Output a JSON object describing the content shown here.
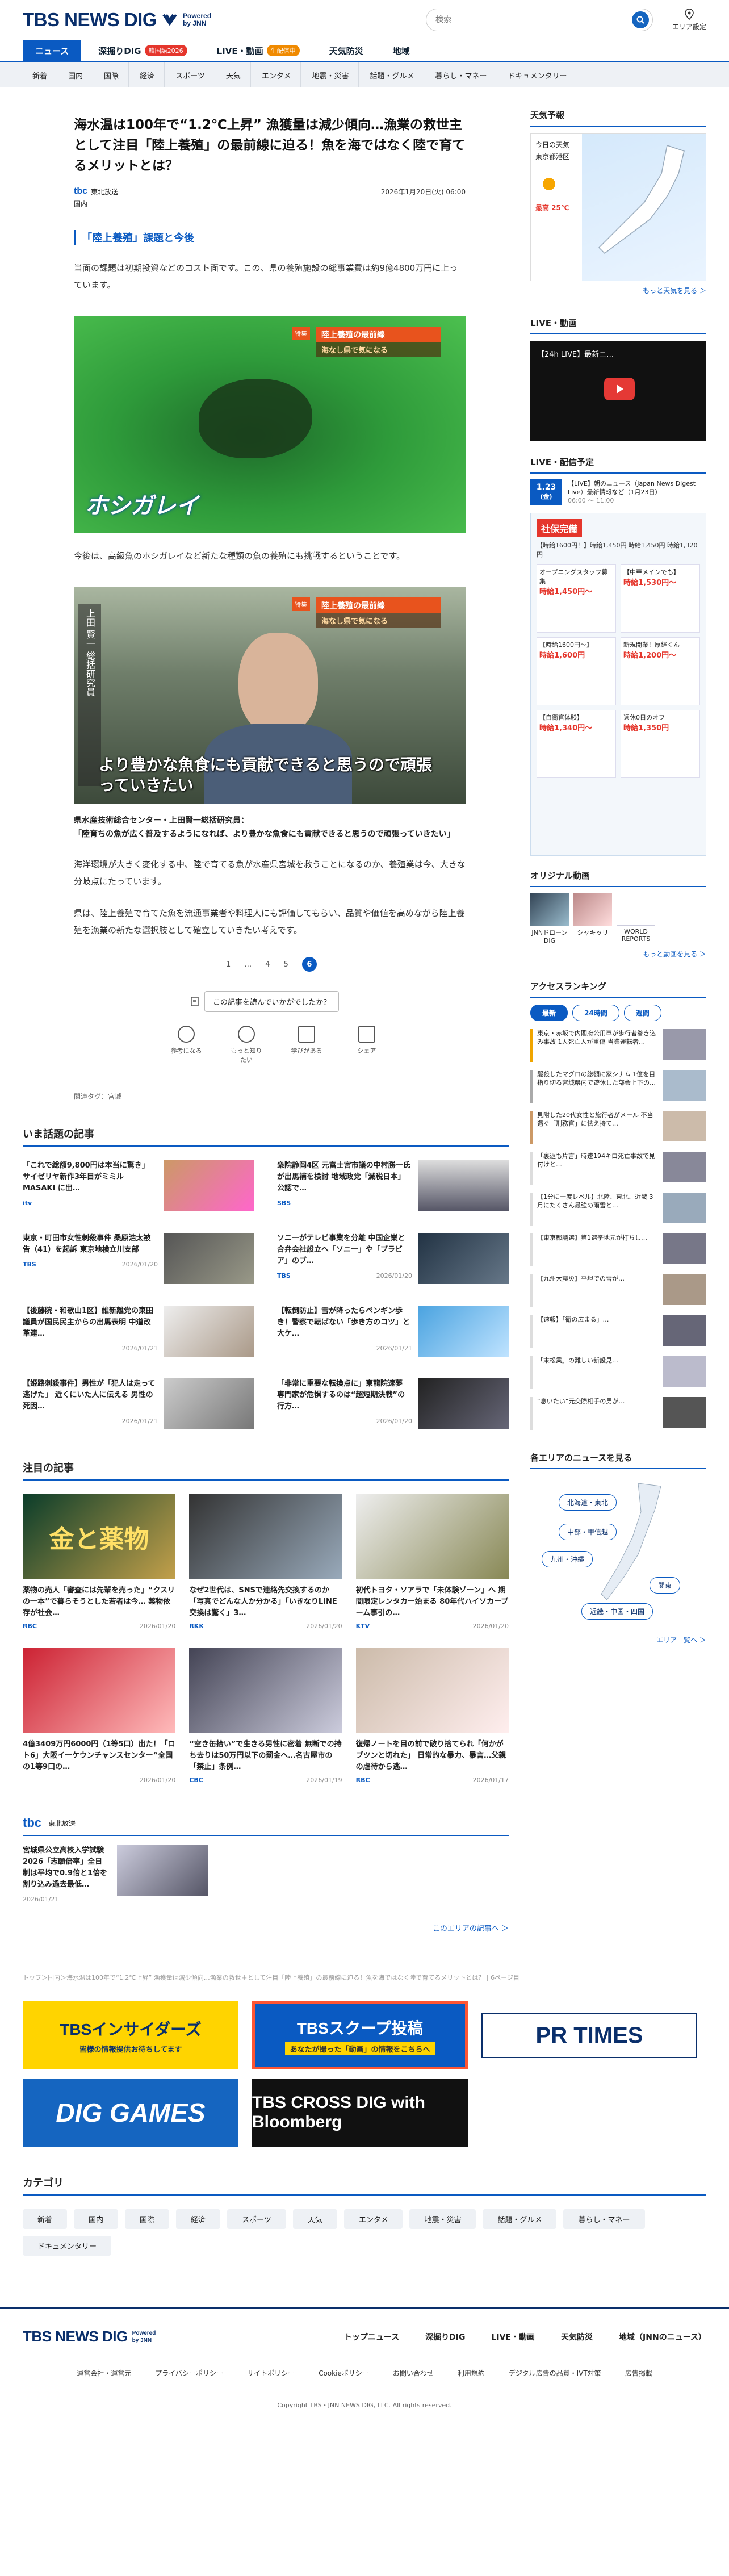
{
  "header": {
    "logo": "TBS NEWS DIG",
    "powered": "Powered",
    "by": "by JNN",
    "search_placeholder": "検索",
    "area_label": "エリア設定"
  },
  "tabs": [
    {
      "label": "ニュース",
      "badge": ""
    },
    {
      "label": "深掘りDIG",
      "badge": "韓国語2026"
    },
    {
      "label": "LIVE・動画",
      "badge": "生配信中"
    },
    {
      "label": "天気防災",
      "badge": ""
    },
    {
      "label": "地域",
      "badge": ""
    }
  ],
  "categories": [
    "新着",
    "国内",
    "国際",
    "経済",
    "スポーツ",
    "天気",
    "エンタメ",
    "地震・災害",
    "話題・グルメ",
    "暮らし・マネー",
    "ドキュメンタリー"
  ],
  "article": {
    "title": "海水温は100年で“1.2℃上昇” 漁獲量は減少傾向…漁業の救世主として注目「陸上養殖」の最前線に迫る！魚を海ではなく陸で育てるメリットとは？",
    "source": "東北放送",
    "source_logo": "tbc",
    "date": "2026年1月20日(火) 06:00",
    "tag": "国内",
    "section_heading": "「陸上養殖」課題と今後",
    "para1": "当面の課題は初期投資などのコスト面です。この、県の養殖施設の総事業費は約9億4800万円に上っています。",
    "img1_caption_tag": "特集",
    "img1_caption_main": "陸上養殖の最前線",
    "img1_caption_sub": "海なし県で気になる",
    "img1_overlay": "ホシガレイ",
    "para2": "今後は、高級魚のホシガレイなど新たな種類の魚の養殖にも挑戦するということです。",
    "img2_caption_tag": "特集",
    "img2_caption_main": "陸上養殖の最前線",
    "img2_caption_sub": "海なし県で気になる",
    "img2_nameband": "上田 賢一 総括研究員",
    "img2_overlay": "より豊かな魚食にも貢献できると思うので頑張っていきたい",
    "speaker": "県水産技術総合センター・上田賢一総括研究員：\n「陸育ちの魚が広く普及するようになれば、より豊かな魚食にも貢献できると思うので頑張っていきたい」",
    "para3": "海洋環境が大きく変化する中、陸で育てる魚が水産県宮城を救うことになるのか、養殖業は今、大きな分岐点にたっています。",
    "para4": "県は、陸上養殖で育てた魚を流通事業者や料理人にも評価してもらい、品質や価値を高めながら陸上養殖を漁業の新たな選択肢として確立していきたい考えです。",
    "pager": [
      "1",
      "…",
      "4",
      "5",
      "6"
    ],
    "feedback_question": "この記事を読んでいかがでしたか？",
    "feedback": [
      "参考になる",
      "もっと知りたい",
      "学びがある",
      "シェア"
    ],
    "related_tag": "関連タグ：宮城"
  },
  "hot_news": {
    "title": "いま話題の記事",
    "items": [
      {
        "text": "「これで総額9,800円は本当に驚き」 サイゼリヤ新作3年目がミミル MASAKI に出…",
        "src": "itv",
        "date": ""
      },
      {
        "text": "衆院静岡4区 元富士宮市議の中村勝一氏が出馬補を検討 地域政党「減税日本」公認で…",
        "src": "SBS",
        "date": ""
      },
      {
        "text": "東京・町田市女性刺殺事件 桑原浩太被告（41）を起訴 東京地検立川支部",
        "src": "TBS",
        "date": "2026/01/20"
      },
      {
        "text": "ソニーがテレビ事業を分離 中国企業と合弁会社設立へ「ソニー」や「ブラビア」のブ…",
        "src": "TBS",
        "date": "2026/01/20"
      },
      {
        "text": "【後藤院・和歌山1区】維新離党の東田議員が国民民主からの出馬表明 中道改革連…",
        "src": "",
        "date": "2026/01/21"
      },
      {
        "text": "【転倒防止】雪が降ったらペンギン歩き！警察で転ばない「歩き方のコツ」と大ケ…",
        "src": "",
        "date": "2026/01/21"
      },
      {
        "text": "【姫路刺殺事件】男性が「犯人は走って逃げた」 近くにいた人に伝える 男性の死因…",
        "src": "",
        "date": "2026/01/21"
      },
      {
        "text": "「非常に重要な転換点に」東龍院速夢 専門家が危惧するのは“超短期決戦”の行方…",
        "src": "",
        "date": "2026/01/20"
      }
    ]
  },
  "featured": {
    "title": "注目の記事",
    "items": [
      {
        "text": "薬物の売人「審査には先輩を売った」“クスリの一本”で暮らそうとした若者は今… 薬物依存が社会…",
        "src": "RBC",
        "date": "2026/01/20",
        "overlay": "金と薬物"
      },
      {
        "text": "なぜ2世代は、SNSで連絡先交換するのか「写真でどんな人か分かる」「いきなりLINE交換は驚く」3…",
        "src": "RKK",
        "date": "2026/01/20",
        "overlay": ""
      },
      {
        "text": "初代トヨタ・ソアラで「未体験ゾーン」へ 期間限定レンタカー始まる 80年代ハイソカーブーム事引の…",
        "src": "KTV",
        "date": "2026/01/20",
        "overlay": ""
      },
      {
        "text": "4億3409万円6000円（1等5口）出た！「ロト6」大阪イーケウンチャンスセンター“全国の1等9口の…",
        "src": "",
        "date": "2026/01/20",
        "overlay": ""
      },
      {
        "text": "“空き缶拾い”で生きる男性に密着 無断での持ち去りは50万円以下の罰金へ…名古屋市の「禁止」条例…",
        "src": "CBC",
        "date": "2026/01/19",
        "overlay": ""
      },
      {
        "text": "復帰ノートを目の前で破り捨てられ「何かがプツンと切れた」 日常的な暴力、暴言…父親の虐待から逃…",
        "src": "RBC",
        "date": "2026/01/17",
        "overlay": ""
      }
    ]
  },
  "local": {
    "source": "東北放送",
    "text": "宮城県公立高校入学試験2026「志願倍率」全日制は平均で0.9倍と1倍を割り込み過去最低…",
    "date": "2026/01/21",
    "link": "このエリアの記事へ ＞"
  },
  "disclaimer": "トップ＞国内＞海水温は100年で“1.2℃上昇” 漁獲量は減少傾向…漁業の救世主として注目「陸上養殖」の最前線に迫る！魚を海ではなく陸で育てるメリットとは？ | 6ページ目",
  "sidebar": {
    "weather_title": "天気予報",
    "weather_today": "今日の天気",
    "weather_area": "東京都港区",
    "weather_temp": "最高 25℃",
    "weather_more": "もっと天気を見る ＞",
    "live_title": "LIVE・動画",
    "live_video_title": "【24h LIVE】最新ニ…",
    "sched_title": "LIVE・配信予定",
    "sched_date": "1.23",
    "sched_day": "(金)",
    "sched_text": "【LIVE】朝のニュース（Japan News Digest Live）最新情報など（1月23日）",
    "sched_time": "06:00 ～ 11:00",
    "ad_badge": "社保完備",
    "ad_head": "【時給1600円！】時給1,450円 時給1,450円 時給1,320円",
    "ad_prices": [
      "時給1,450円～",
      "時給1,530円～",
      "時給1,600円",
      "時給1,200円～",
      "時給1,340円～",
      "時給1,350円"
    ],
    "ad_titles": [
      "オープニングスタッフ募集",
      "【中華メインでも】",
      "【時給1600円～】",
      "新規開業！厚経くん",
      "【自衛官体験】",
      "週休0日のオフ"
    ],
    "orig_title": "オリジナル動画",
    "orig_items": [
      "JNNドローンDIG",
      "シャキッリ",
      "WORLD REPORTS"
    ],
    "orig_more": "もっと動画を見る ＞",
    "rank_title": "アクセスランキング",
    "rank_tabs": [
      "最新",
      "24時間",
      "週間"
    ],
    "rank_items": [
      "東京・赤坂で内閣府公用車が歩行者巻き込み事故 1人死亡人が重傷 当業運転者…",
      "駆殺したマグロの総額に家シナム 1億を目指り切る宮城県内で遊休した部会上下の…",
      "見附した20代女性と旅行者がメール 不当遇ぐ「刑務官」に怯え持て…",
      "「裏返も片言」時速194キロ死亡事故で見付けと…",
      "【1分に一度レベル】北陸、東北、近畿 3月にたくさん最強の雨雪と…",
      "【東京都議選】第1選挙地元が打ちし…",
      "【九州大震災】平坦での雪が…",
      "【速報】「衛の広まる」…",
      "「末松業」の難しい新設見…",
      "“息いたい”元交際相手の男が…"
    ],
    "area_title": "各エリアのニュースを見る",
    "areas": [
      "北海道・東北",
      "中部・甲信越",
      "九州・沖縄",
      "関東",
      "近畿・中国・四国"
    ],
    "area_more": "エリア一覧へ ＞"
  },
  "banners": [
    "TBSインサイダーズ",
    "TBSスクープ投稿",
    "PR TIMES",
    "DIG GAMES",
    "TBS CROSS DIG with Bloomberg"
  ],
  "banner_sub": [
    "皆様の情報提供お待ちしてます",
    "あなたが撮った「動画」の情報をこちらへ"
  ],
  "category_section": {
    "title": "カテゴリ",
    "items": [
      "新着",
      "国内",
      "国際",
      "経済",
      "スポーツ",
      "天気",
      "エンタメ",
      "地震・災害",
      "話題・グルメ",
      "暮らし・マネー",
      "ドキュメンタリー"
    ]
  },
  "footer": {
    "nav": [
      "トップニュース",
      "深掘りDIG",
      "LIVE・動画",
      "天気防災",
      "地域（JNNのニュース）"
    ],
    "links": [
      "運営会社・運営元",
      "プライバシーポリシー",
      "サイトポリシー",
      "Cookieポリシー",
      "お問い合わせ",
      "利用規約",
      "デジタル広告の品質・IVT対策",
      "広告掲載"
    ],
    "copyright": "Copyright TBS・JNN NEWS DIG, LLC. All rights reserved."
  }
}
